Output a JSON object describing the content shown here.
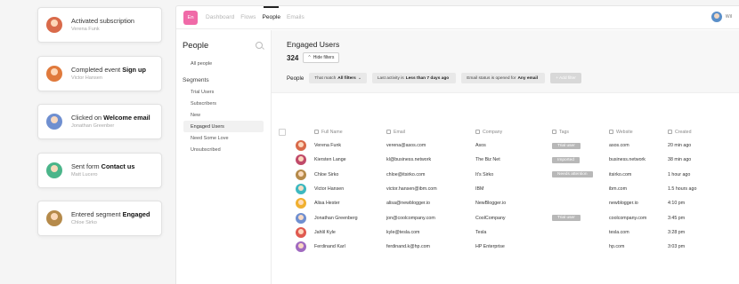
{
  "activity_cards": [
    {
      "title": "Activated subscription",
      "bold": "",
      "person": "Verena Funk",
      "avatar_color": "#d96a4a"
    },
    {
      "title": "Completed event ",
      "bold": "Sign up",
      "person": "Victor Hansen",
      "avatar_color": "#e07a3c"
    },
    {
      "title": "Clicked on ",
      "bold": "Welcome email",
      "person": "Jonathan Greenber",
      "avatar_color": "#6f8fd0"
    },
    {
      "title": "Sent form ",
      "bold": "Contact us",
      "person": "Matt Lucero",
      "avatar_color": "#4bb58a"
    },
    {
      "title": "Entered segment ",
      "bold": "Engaged",
      "person": "Chloe Sirko",
      "avatar_color": "#b58a4a"
    }
  ],
  "app": {
    "logo": "En",
    "nav": [
      "Dashboard",
      "Flows",
      "People",
      "Emails"
    ],
    "active_nav": "People",
    "user": "Wil"
  },
  "sidebar": {
    "title": "People",
    "all_people": "All people",
    "segments_label": "Segments",
    "segments": [
      "Trial Users",
      "Subscribers",
      "New",
      "Engaged Users",
      "Need Some Love",
      "Unsubscribed"
    ],
    "active_segment": "Engaged Users"
  },
  "main": {
    "title": "Engaged Users",
    "count": "324",
    "hide_filters": "Hide filters",
    "filter_label": "People",
    "filters": [
      {
        "pre": "That match",
        "bold": "All filters",
        "post": "⌄"
      },
      {
        "pre": "Last activity is",
        "bold": "Less than 7 days ago",
        "post": ""
      },
      {
        "pre": "Email status is opened for",
        "bold": "Any email",
        "post": ""
      }
    ],
    "add_filter": "+ Add filter"
  },
  "table": {
    "columns": [
      "Full Name",
      "Email",
      "Company",
      "Tags",
      "Website",
      "Created"
    ],
    "rows": [
      {
        "name": "Verena Funk",
        "email": "verena@asos.com",
        "company": "Asos",
        "tag": "Trial user",
        "website": "asos.com",
        "created": "20 min ago",
        "color": "#d96a4a"
      },
      {
        "name": "Kiersten Lange",
        "email": "kl@business.network",
        "company": "The Biz Net",
        "tag": "Imported",
        "website": "business.network",
        "created": "38 min ago",
        "color": "#c04a6a"
      },
      {
        "name": "Chloe Sirko",
        "email": "chloe@itsirko.com",
        "company": "It's Sirko",
        "tag": "Needs attention",
        "website": "itsirko.com",
        "created": "1 hour ago",
        "color": "#b58a4a"
      },
      {
        "name": "Victor Hansen",
        "email": "victor.hansen@ibm.com",
        "company": "IBM",
        "tag": "",
        "website": "ibm.com",
        "created": "1.5 hours ago",
        "color": "#3cb8c0"
      },
      {
        "name": "Alisa Hester",
        "email": "alisa@newblogger.io",
        "company": "NewBlogger.io",
        "tag": "",
        "website": "newblogger.io",
        "created": "4:10 pm",
        "color": "#f0b030"
      },
      {
        "name": "Jonathan Greenberg",
        "email": "jon@coolcompany.com",
        "company": "CoolCompany",
        "tag": "Trial user",
        "website": "coolcompany.com",
        "created": "3:45 pm",
        "color": "#6f8fd0"
      },
      {
        "name": "Jahlil Kyle",
        "email": "kyle@tesla.com",
        "company": "Tesla",
        "tag": "",
        "website": "tesla.com",
        "created": "3:28 pm",
        "color": "#e05a50"
      },
      {
        "name": "Ferdinand Karl",
        "email": "ferdinand.k@hp.com",
        "company": "HP Enterprise",
        "tag": "",
        "website": "hp.com",
        "created": "3:03 pm",
        "color": "#a06ac0"
      }
    ]
  }
}
